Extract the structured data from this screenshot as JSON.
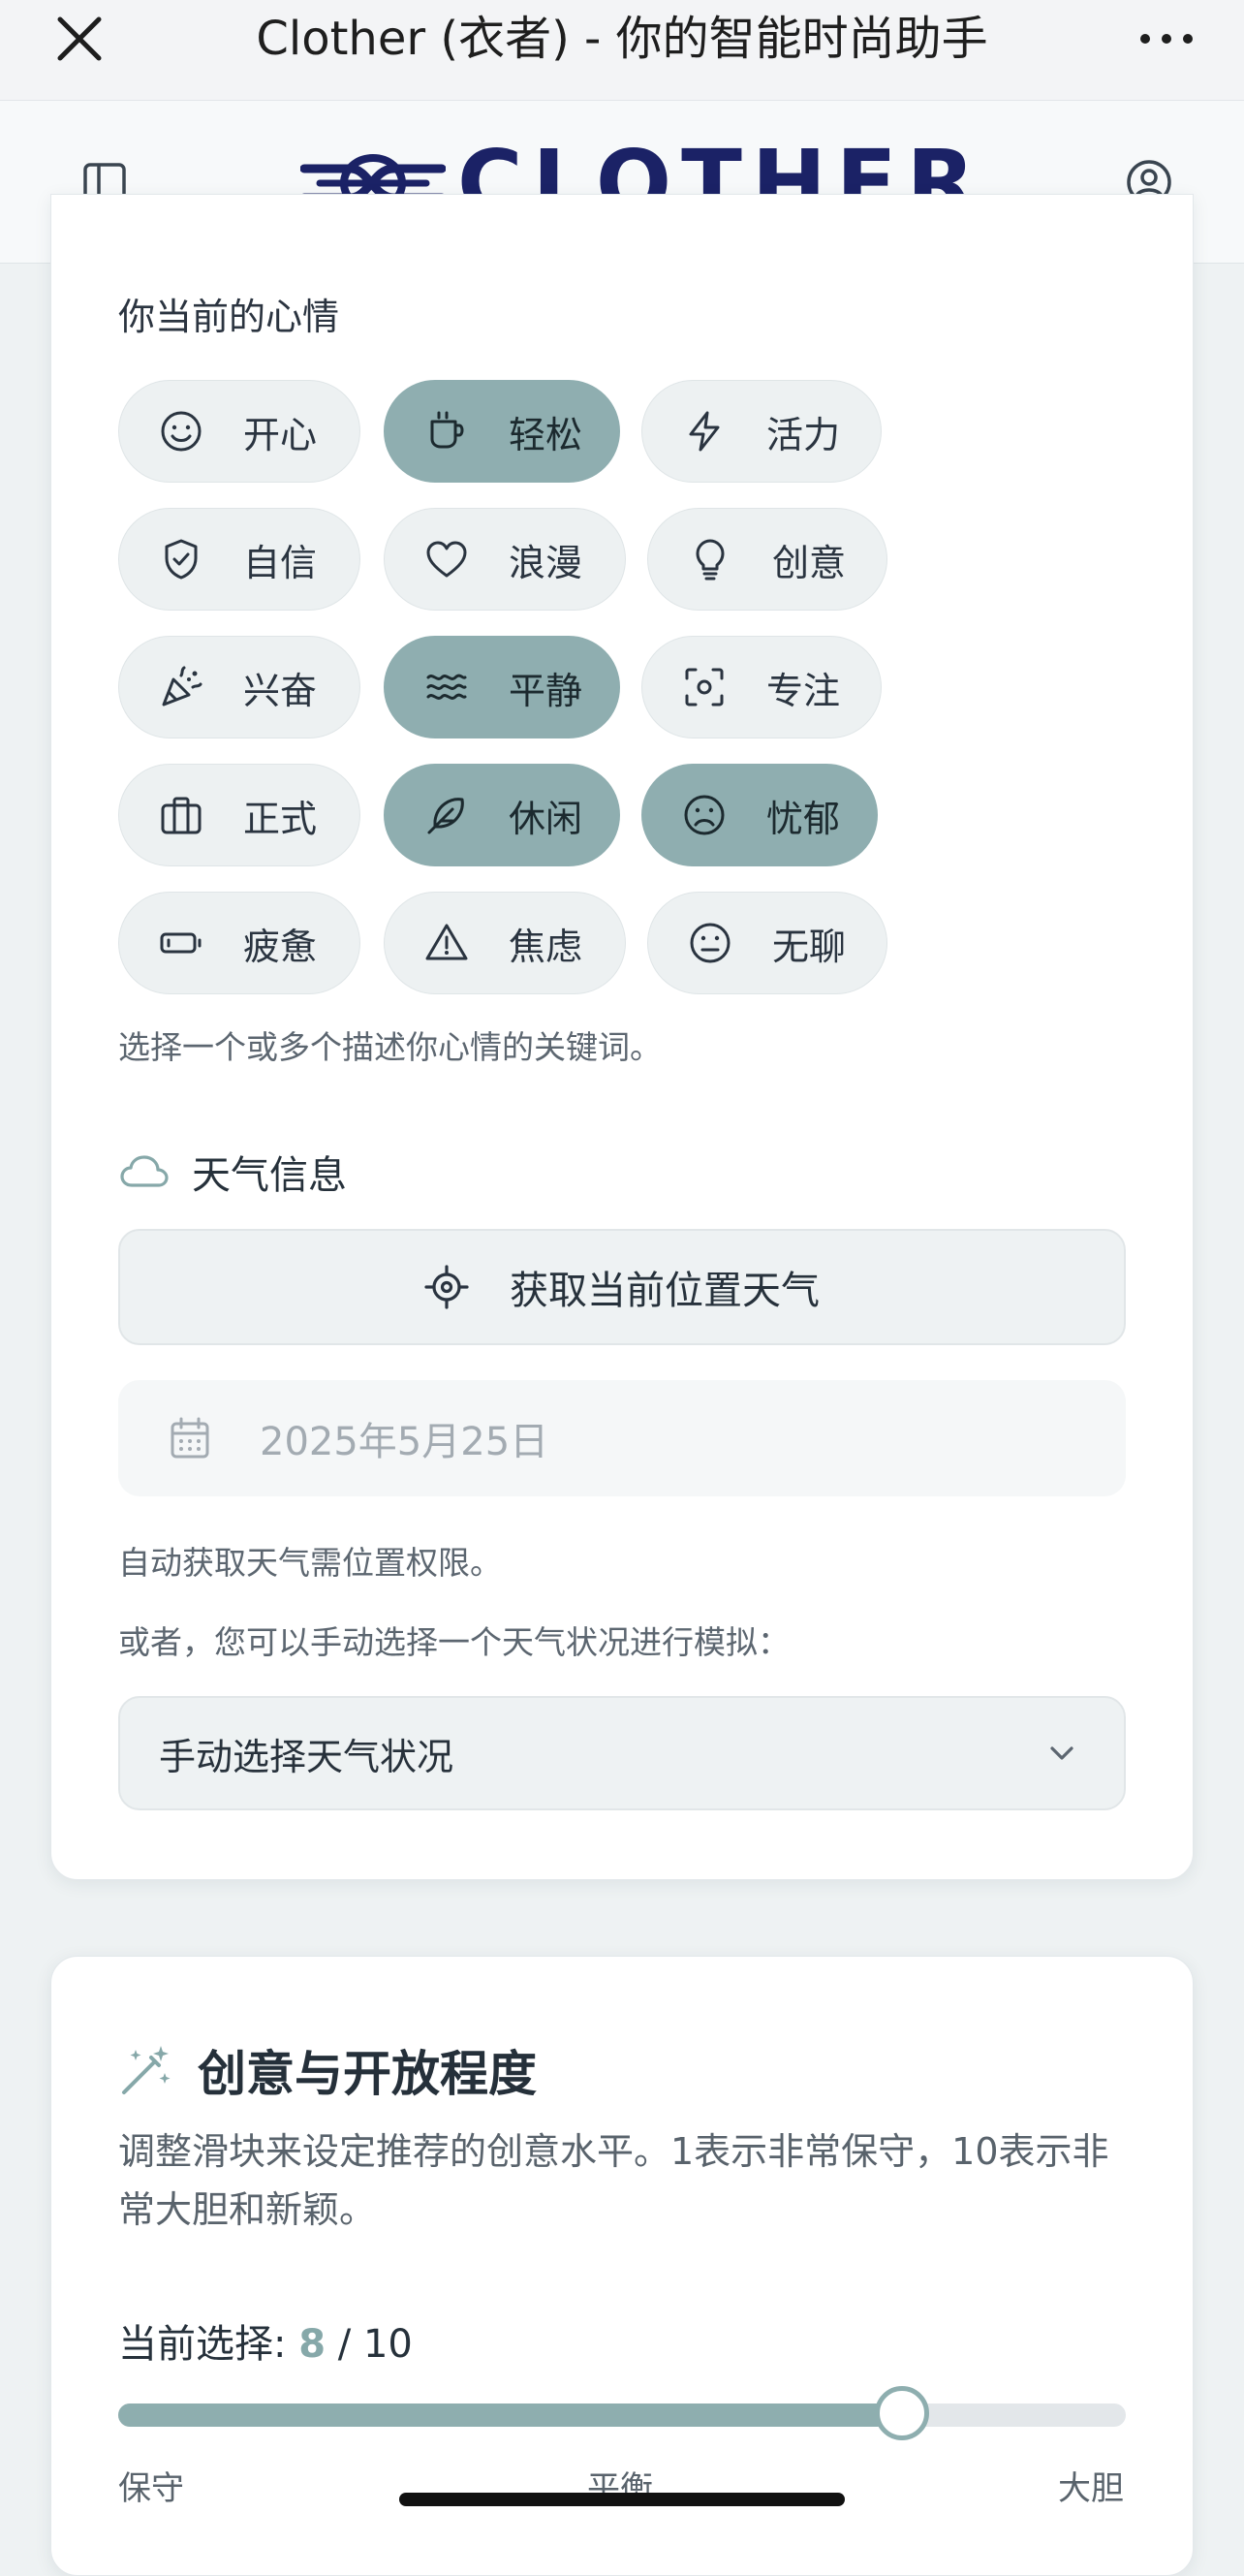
{
  "browser": {
    "title": "Clother (衣者) - 你的智能时尚助手",
    "close_icon": "close-icon",
    "more_icon": "more-horizontal-icon"
  },
  "header": {
    "logo_text": "CLOTHER",
    "logo_mark": "knot-logo",
    "brand_color": "#1b2266",
    "sidebar_icon": "sidebar-panel-icon",
    "profile_icon": "user-circle-icon"
  },
  "mood": {
    "label": "你当前的心情",
    "chips": [
      {
        "label": "开心",
        "icon": "smile-icon",
        "selected": false
      },
      {
        "label": "轻松",
        "icon": "coffee-cup-icon",
        "selected": true
      },
      {
        "label": "活力",
        "icon": "lightning-icon",
        "selected": false
      },
      {
        "label": "自信",
        "icon": "shield-check-icon",
        "selected": false
      },
      {
        "label": "浪漫",
        "icon": "heart-icon",
        "selected": false
      },
      {
        "label": "创意",
        "icon": "lightbulb-icon",
        "selected": false
      },
      {
        "label": "兴奋",
        "icon": "party-popper-icon",
        "selected": false
      },
      {
        "label": "平静",
        "icon": "waves-icon",
        "selected": true
      },
      {
        "label": "专注",
        "icon": "focus-frame-icon",
        "selected": false
      },
      {
        "label": "正式",
        "icon": "briefcase-icon",
        "selected": false
      },
      {
        "label": "休闲",
        "icon": "feather-icon",
        "selected": true
      },
      {
        "label": "忧郁",
        "icon": "frown-icon",
        "selected": true
      },
      {
        "label": "疲惫",
        "icon": "battery-low-icon",
        "selected": false
      },
      {
        "label": "焦虑",
        "icon": "warning-triangle-icon",
        "selected": false
      },
      {
        "label": "无聊",
        "icon": "meh-face-icon",
        "selected": false
      }
    ],
    "helper": "选择一个或多个描述你心情的关键词。",
    "selected_color": "#8faeb0",
    "unselected_color": "#edf1f2"
  },
  "weather": {
    "label": "天气信息",
    "locate_button": "获取当前位置天气",
    "date_value": "2025年5月25日",
    "permission_note": "自动获取天气需位置权限。",
    "manual_note": "或者，您可以手动选择一个天气状况进行模拟：",
    "manual_select": "手动选择天气状况"
  },
  "creativity": {
    "title": "创意与开放程度",
    "description": "调整滑块来设定推荐的创意水平。1表示非常保守，10表示非常大胆和新颖。",
    "current_label": "当前选择:",
    "current_value": "8",
    "max_text": "/ 10",
    "slider_value": 8,
    "slider_min": 1,
    "slider_max": 10,
    "scale_low": "保守",
    "scale_mid": "平衡",
    "scale_high": "大胆",
    "accent_color": "#8eaeaf"
  }
}
